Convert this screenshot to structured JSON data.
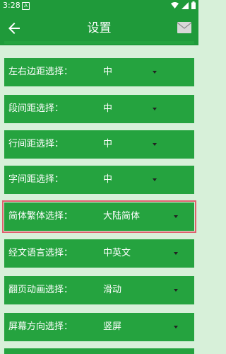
{
  "status_bar": {
    "time": "3:28",
    "notif_letter": "A"
  },
  "app_bar": {
    "title": "设置",
    "back_icon": "back-arrow-icon",
    "mail_icon": "mail-icon"
  },
  "settings": [
    {
      "label": "左右边距选择：",
      "value": "中"
    },
    {
      "label": "段间距选择：",
      "value": "中"
    },
    {
      "label": "行间距选择：",
      "value": "中"
    },
    {
      "label": "字间距选择：",
      "value": "中"
    },
    {
      "label": "简体繁体选择：",
      "value": "大陆简体"
    },
    {
      "label": "经文语言选择：",
      "value": "中英文"
    },
    {
      "label": "翻页动画选择：",
      "value": "滑动"
    },
    {
      "label": "屏幕方向选择：",
      "value": "竖屏"
    }
  ],
  "colors": {
    "header": "#1f9a3a",
    "row": "#25a33f",
    "background": "#d7f0d9",
    "highlight": "#e0606e"
  }
}
